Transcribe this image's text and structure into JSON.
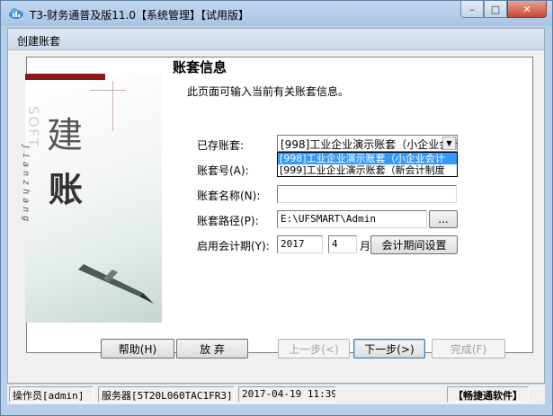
{
  "window": {
    "title": "T3-财务通普及版11.0【系统管理】【试用版】",
    "min": "–",
    "max": "□",
    "close": "✕"
  },
  "dialog": {
    "title": "创建账套"
  },
  "art": {
    "jian": "建",
    "zhang": "账",
    "vertical_en": "SOFT",
    "vertical_pinyin": "jianzhang"
  },
  "form": {
    "heading": "账套信息",
    "description": "此页面可输入当前有关账套信息。",
    "existing_label": "已存账套:",
    "existing_value": "[998]工业企业演示账套（小企业会计",
    "existing_options": [
      "[998]工业企业演示账套（小企业会计",
      "[999]工业企业演示账套（新会计制度"
    ],
    "code_label": "账套号(A):",
    "name_label": "账套名称(N):",
    "name_value": "",
    "path_label": "账套路径(P):",
    "path_value": "E:\\UFSMART\\Admin",
    "browse_label": "...",
    "period_label": "启用会计期(Y):",
    "year_value": "2017",
    "month_value": "4",
    "month_unit": "月",
    "period_settings_label": "会计期间设置"
  },
  "buttons": {
    "help": "帮助(H)",
    "abandon": "放  弃",
    "prev": "上一步(<)",
    "next": "下一步(>)",
    "finish": "完成(F)"
  },
  "status": {
    "operator": "操作员[admin]",
    "server": "服务器[5T20L060TAC1FR3]",
    "datetime": "2017-04-19 11:39",
    "brand": "【畅捷通软件】"
  }
}
